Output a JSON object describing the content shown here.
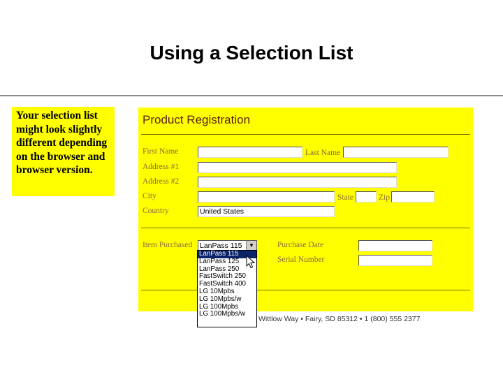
{
  "slide": {
    "title": "Using a Selection List",
    "note": "Your selection list might look slightly different depending on the browser and browser version."
  },
  "form": {
    "title": "Product Registration",
    "labels": {
      "first_name": "First Name",
      "last_name": "Last Name",
      "address1": "Address #1",
      "address2": "Address #2",
      "city": "City",
      "state": "State",
      "zip": "Zip",
      "country": "Country",
      "item_purchased": "Item Purchased",
      "purchase_date": "Purchase Date",
      "serial_number": "Serial Number"
    },
    "values": {
      "country": "United States",
      "item_purchased": "LanPass 115"
    },
    "footer": "Wittlow Way • Fairy, SD 85312 • 1 (800) 555 2377"
  },
  "dropdown": {
    "options": [
      "LanPass 115",
      "LanPass 125",
      "LanPass 250",
      "FastSwitch 250",
      "FastSwitch 400",
      "LG 10Mpbs",
      "LG 10Mpbs/w",
      "LG 100Mpbs",
      "LG 100Mpbs/w"
    ],
    "selected_index": 0
  },
  "colors": {
    "note_bg": "#ffff00",
    "form_bg": "#ffff00",
    "form_title": "#5a1f10",
    "label": "#8b6a3a",
    "highlight": "#0a246a"
  }
}
